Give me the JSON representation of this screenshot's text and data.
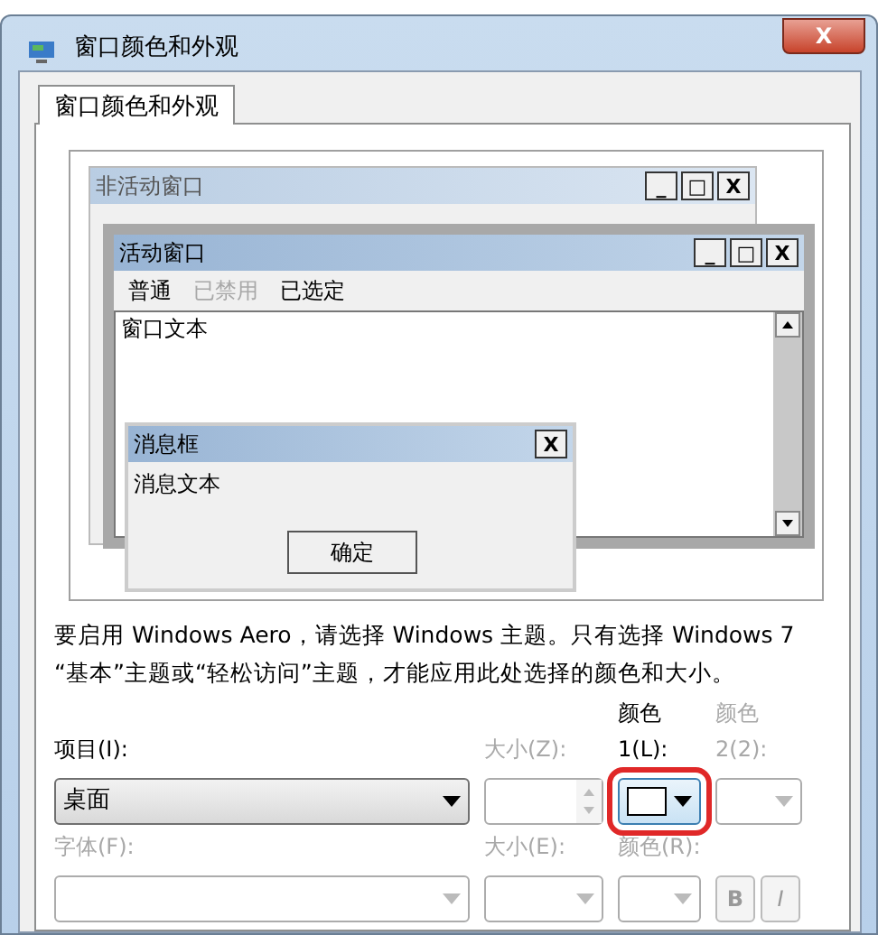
{
  "window": {
    "title": "窗口颜色和外观",
    "close": "X"
  },
  "tabs": [
    {
      "label": "窗口颜色和外观",
      "selected": true
    }
  ],
  "preview": {
    "inactive_window": {
      "title": "非活动窗口",
      "buttons": [
        "_",
        "□",
        "X"
      ]
    },
    "active_window": {
      "title": "活动窗口",
      "buttons": [
        "_",
        "□",
        "X"
      ],
      "menu": [
        {
          "label": "普通",
          "disabled": false
        },
        {
          "label": "已禁用",
          "disabled": true
        },
        {
          "label": "已选定",
          "disabled": false
        }
      ],
      "text": "窗口文本"
    },
    "message_box": {
      "title": "消息框",
      "close": "X",
      "text": "消息文本",
      "button": "确定"
    }
  },
  "note": "要启用 Windows Aero，请选择 Windows 主题。只有选择 Windows 7 “基本”主题或“轻松访问”主题，才能应用此处选择的颜色和大小。",
  "row1": [
    {
      "kind": "select",
      "label": "项目(I):",
      "value": "桌面",
      "disabled": false
    },
    {
      "kind": "spin",
      "label": "大小(Z):",
      "disabled": true
    },
    {
      "kind": "color",
      "label": "颜色 1(L):",
      "disabled": false,
      "color": "#ffffff",
      "highlighted": true
    },
    {
      "kind": "color",
      "label": "颜色 2(2):",
      "disabled": true,
      "highlighted": false
    }
  ],
  "row2": [
    {
      "kind": "select",
      "label": "字体(F):",
      "disabled": true
    },
    {
      "kind": "select",
      "label": "大小(E):",
      "disabled": true
    },
    {
      "kind": "color",
      "label": "颜色(R):",
      "disabled": true,
      "highlighted": false
    },
    {
      "kind": "toggles",
      "buttons": [
        {
          "label": "B",
          "bold": true
        },
        {
          "label": "I",
          "bold": false
        }
      ],
      "disabled": true
    }
  ]
}
